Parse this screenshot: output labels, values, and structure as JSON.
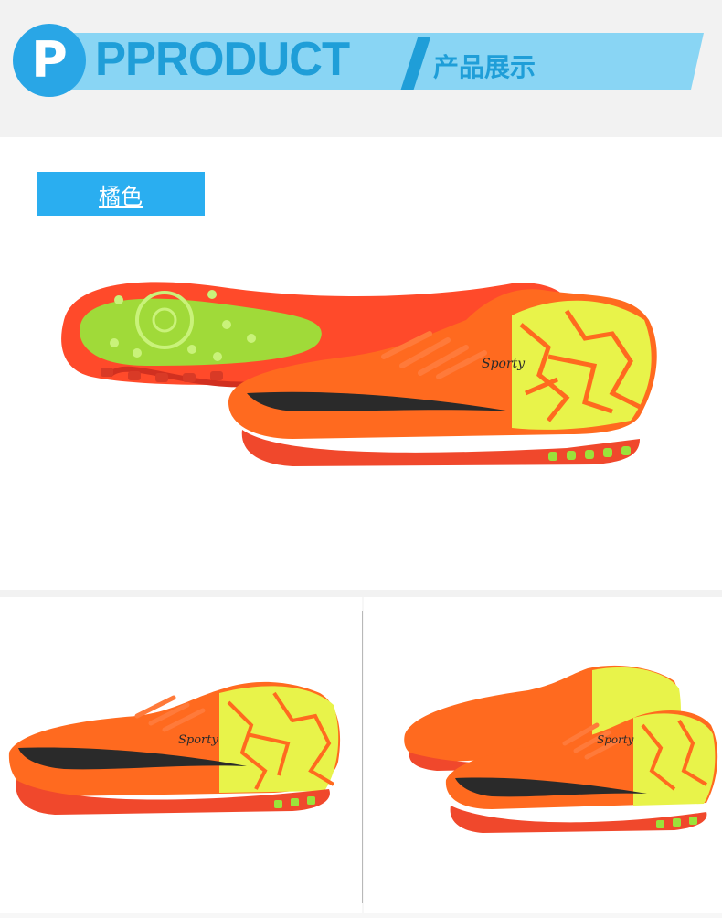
{
  "header": {
    "badge_letter": "P",
    "title": "PPRODUCT",
    "subtitle": "产品展示"
  },
  "main": {
    "color_tag": "橘色",
    "brand_text": "Sporty"
  },
  "thumbnails": {
    "left_brand": "Sporty",
    "right_brand": "Sporty"
  },
  "colors": {
    "accent_blue": "#2aaef0",
    "band_light_blue": "#89d5f4",
    "shoe_orange": "#ff6a1f",
    "shoe_neon": "#e8f34a",
    "sole_green": "#9be23a"
  }
}
